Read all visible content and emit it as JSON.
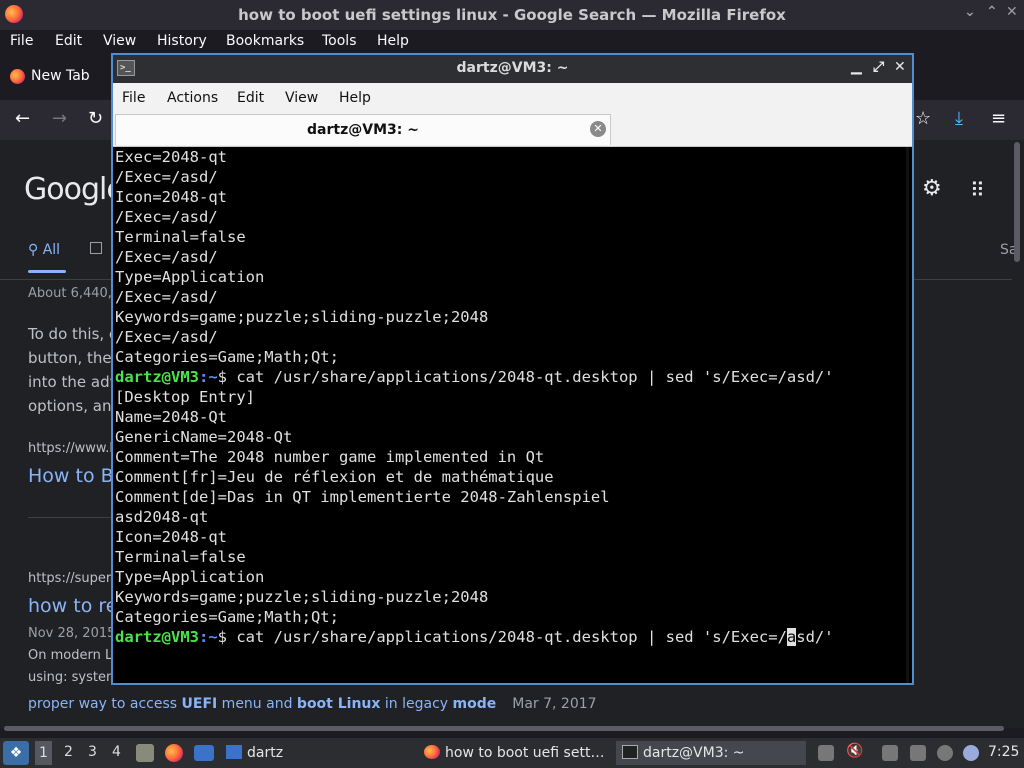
{
  "firefox": {
    "window_title": "how to boot uefi settings linux - Google Search — Mozilla Firefox",
    "menu": [
      "File",
      "Edit",
      "View",
      "History",
      "Bookmarks",
      "Tools",
      "Help"
    ],
    "tab_label": "New Tab"
  },
  "google": {
    "logo": "Google",
    "tab_all": "All",
    "tab_right": "Sa",
    "result_stats": "About 6,440,",
    "snippet": [
      "To do this, c",
      "button, then",
      "into the adv",
      "options, and"
    ],
    "result1_cite": "https://www.h",
    "result1_title": "How to B",
    "result2_cite": "https://superu",
    "result2_title": "how to re",
    "result2_date": "Nov 28, 2015",
    "result2_snippet": [
      "On modern L",
      "using: system"
    ],
    "bottom_link_parts": [
      "proper way to access ",
      "UEFI",
      " menu and ",
      "boot Linux",
      " in legacy ",
      "mode"
    ],
    "bottom_date": "Mar 7, 2017"
  },
  "terminal": {
    "title": "dartz@VM3: ~",
    "menu": [
      "File",
      "Actions",
      "Edit",
      "View",
      "Help"
    ],
    "tab_label": "dartz@VM3: ~",
    "prompt_user": "dartz@VM3",
    "prompt_path": ":~",
    "prompt_sym": "$ ",
    "output_before": [
      "Exec=2048-qt",
      "/Exec=/asd/",
      "Icon=2048-qt",
      "/Exec=/asd/",
      "Terminal=false",
      "/Exec=/asd/",
      "Type=Application",
      "/Exec=/asd/",
      "Keywords=game;puzzle;sliding-puzzle;2048",
      "/Exec=/asd/",
      "Categories=Game;Math;Qt;"
    ],
    "command1": "cat /usr/share/applications/2048-qt.desktop | sed 's/Exec=/asd/'",
    "output_after": [
      "[Desktop Entry]",
      "Name=2048-Qt",
      "GenericName=2048-Qt",
      "Comment=The 2048 number game implemented in Qt",
      "Comment[fr]=Jeu de réflexion et de mathématique",
      "Comment[de]=Das in QT implementierte 2048-Zahlenspiel",
      "asd2048-qt",
      "Icon=2048-qt",
      "Terminal=false",
      "Type=Application",
      "Keywords=game;puzzle;sliding-puzzle;2048",
      "Categories=Game;Math;Qt;"
    ],
    "command2_before_cursor": "cat /usr/share/applications/2048-qt.desktop | sed 's/Exec=/",
    "command2_cursor_char": "a",
    "command2_after_cursor": "sd/'"
  },
  "taskbar": {
    "workspaces": [
      "1",
      "2",
      "3",
      "4"
    ],
    "folder_window": "dartz",
    "firefox_window": "how to boot uefi sett…",
    "terminal_window": "dartz@VM3: ~",
    "clock": "7:25"
  }
}
